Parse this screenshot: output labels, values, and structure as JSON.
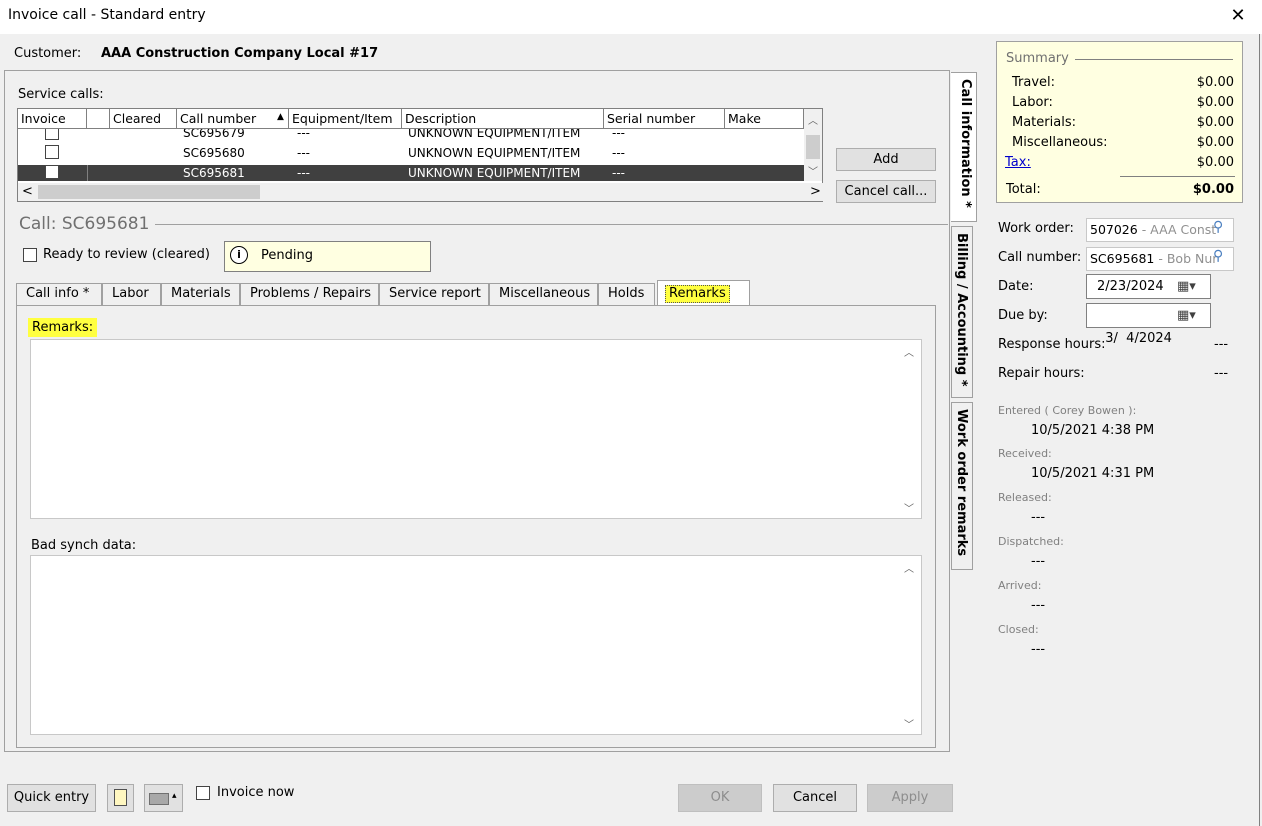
{
  "window": {
    "title": "Invoice call - Standard entry"
  },
  "customer": {
    "label": "Customer:",
    "name": "AAA Construction Company Local #17"
  },
  "service_calls": {
    "label": "Service calls:",
    "columns": [
      "Invoice",
      "",
      "Cleared",
      "Call number",
      "Equipment/Item",
      "Description",
      "Serial number",
      "Make"
    ],
    "rows": [
      {
        "call_number": "SC695679",
        "equipment": "---",
        "description": "UNKNOWN EQUIPMENT/ITEM",
        "serial": "---"
      },
      {
        "call_number": "SC695680",
        "equipment": "---",
        "description": "UNKNOWN EQUIPMENT/ITEM",
        "serial": "---"
      },
      {
        "call_number": "SC695681",
        "equipment": "---",
        "description": "UNKNOWN EQUIPMENT/ITEM",
        "serial": "---"
      }
    ]
  },
  "buttons": {
    "add": "Add",
    "cancel_call": "Cancel call...",
    "quick_entry": "Quick entry",
    "ok": "OK",
    "cancel": "Cancel",
    "apply": "Apply"
  },
  "call": {
    "title": "Call: SC695681",
    "ready_to_review": "Ready to review (cleared)",
    "status": "Pending"
  },
  "tabs": [
    "Call info *",
    "Labor",
    "Materials",
    "Problems / Repairs",
    "Service report",
    "Miscellaneous",
    "Holds",
    "Remarks"
  ],
  "remarks": {
    "label": "Remarks:",
    "bad_synch_label": "Bad synch data:",
    "remarks_value": "",
    "bad_synch_value": ""
  },
  "side_tabs": [
    "Call information *",
    "Billing / Accounting *",
    "Work order remarks"
  ],
  "summary": {
    "title": "Summary",
    "rows": [
      {
        "label": "Travel:",
        "value": "$0.00"
      },
      {
        "label": "Labor:",
        "value": "$0.00"
      },
      {
        "label": "Materials:",
        "value": "$0.00"
      },
      {
        "label": "Miscellaneous:",
        "value": "$0.00"
      },
      {
        "label": "Tax:",
        "value": "$0.00"
      }
    ],
    "total_label": "Total:",
    "total_value": "$0.00"
  },
  "details": {
    "work_order_label": "Work order:",
    "work_order_number": "507026",
    "work_order_name": " - AAA Const",
    "call_number_label": "Call number:",
    "call_number_value": "SC695681",
    "call_number_name": " - Bob Nur",
    "date_label": "Date:",
    "date_value": "2/23/2024",
    "due_by_label": "Due by:",
    "due_by_value": "3/  4/2024",
    "response_hours_label": "Response hours:",
    "response_hours_value": "---",
    "repair_hours_label": "Repair hours:",
    "repair_hours_value": "---",
    "entered_label": "Entered ( Corey Bowen ):",
    "entered_value": "10/5/2021 4:38 PM",
    "received_label": "Received:",
    "received_value": "10/5/2021 4:31 PM",
    "released_label": "Released:",
    "released_value": "---",
    "dispatched_label": "Dispatched:",
    "dispatched_value": "---",
    "arrived_label": "Arrived:",
    "arrived_value": "---",
    "closed_label": "Closed:",
    "closed_value": "---"
  },
  "footer": {
    "invoice_now": "Invoice now"
  },
  "colors": {
    "highlight": "#ffff40",
    "summary_bg": "#ffffe1",
    "selected_row": "#404040",
    "link": "#0000cc"
  }
}
